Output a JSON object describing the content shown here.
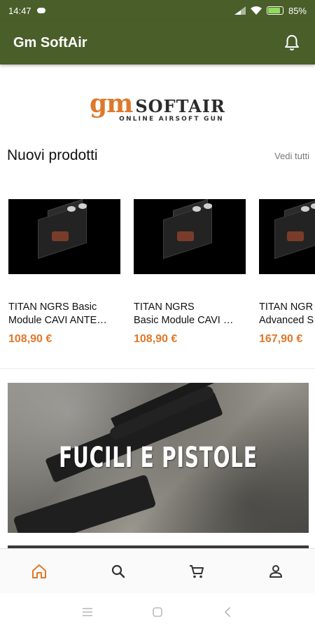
{
  "status_bar": {
    "time": "14:47",
    "battery": "85%",
    "battery_level": 0.85
  },
  "app_bar": {
    "title": "Gm SoftAir"
  },
  "logo": {
    "brand_main": "gm",
    "brand_secondary": "SOFTAIR",
    "tagline": "ONLINE AIRSOFT GUN"
  },
  "section": {
    "title": "Nuovi prodotti",
    "see_all": "Vedi tutti"
  },
  "products": [
    {
      "name_line1": "TITAN NGRS Basic",
      "name_line2": "Module CAVI ANTE…",
      "price": "108,90 €"
    },
    {
      "name_line1": "TITAN NGRS",
      "name_line2": "Basic Module CAVI …",
      "price": "108,90 €"
    },
    {
      "name_line1": "TITAN NGR",
      "name_line2": "Advanced S",
      "price": "167,90 €"
    }
  ],
  "banner": {
    "title": "FUCILI E PISTOLE"
  },
  "bottom_nav": {
    "items": [
      "home-icon",
      "search-icon",
      "cart-icon",
      "account-icon"
    ],
    "active": "home-icon"
  },
  "colors": {
    "primary": "#4a5e2a",
    "accent": "#e0782a",
    "icon": "#333333"
  }
}
